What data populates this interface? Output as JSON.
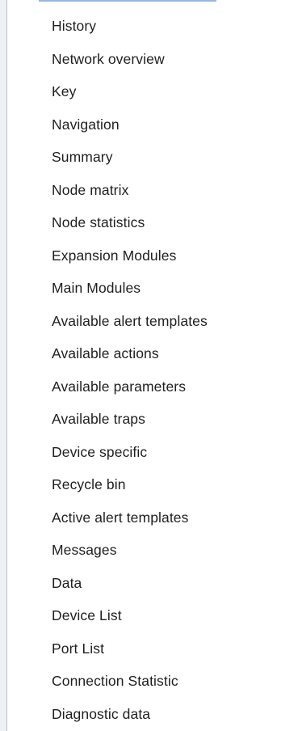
{
  "menu": {
    "items": [
      {
        "label": "History"
      },
      {
        "label": "Network overview"
      },
      {
        "label": "Key"
      },
      {
        "label": "Navigation"
      },
      {
        "label": "Summary"
      },
      {
        "label": "Node matrix"
      },
      {
        "label": "Node statistics"
      },
      {
        "label": "Expansion Modules"
      },
      {
        "label": "Main Modules"
      },
      {
        "label": "Available alert templates"
      },
      {
        "label": "Available actions"
      },
      {
        "label": "Available parameters"
      },
      {
        "label": "Available traps"
      },
      {
        "label": "Device specific"
      },
      {
        "label": "Recycle bin"
      },
      {
        "label": "Active alert templates"
      },
      {
        "label": "Messages"
      },
      {
        "label": "Data"
      },
      {
        "label": "Device List"
      },
      {
        "label": "Port List"
      },
      {
        "label": "Connection Statistic"
      },
      {
        "label": "Diagnostic data"
      }
    ]
  },
  "colors": {
    "background": "#ffffff",
    "text": "#1f1f1f",
    "left_edge": "#eef0f3",
    "accent": "#3f7bd6"
  }
}
